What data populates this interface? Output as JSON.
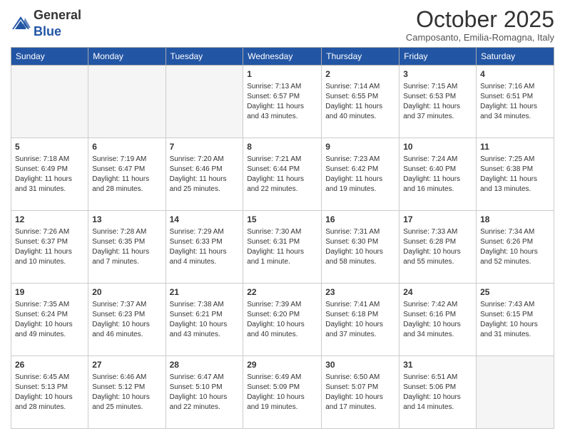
{
  "header": {
    "logo_general": "General",
    "logo_blue": "Blue",
    "month_title": "October 2025",
    "location": "Camposanto, Emilia-Romagna, Italy"
  },
  "days_of_week": [
    "Sunday",
    "Monday",
    "Tuesday",
    "Wednesday",
    "Thursday",
    "Friday",
    "Saturday"
  ],
  "weeks": [
    [
      {
        "day": "",
        "info": ""
      },
      {
        "day": "",
        "info": ""
      },
      {
        "day": "",
        "info": ""
      },
      {
        "day": "1",
        "info": "Sunrise: 7:13 AM\nSunset: 6:57 PM\nDaylight: 11 hours and 43 minutes."
      },
      {
        "day": "2",
        "info": "Sunrise: 7:14 AM\nSunset: 6:55 PM\nDaylight: 11 hours and 40 minutes."
      },
      {
        "day": "3",
        "info": "Sunrise: 7:15 AM\nSunset: 6:53 PM\nDaylight: 11 hours and 37 minutes."
      },
      {
        "day": "4",
        "info": "Sunrise: 7:16 AM\nSunset: 6:51 PM\nDaylight: 11 hours and 34 minutes."
      }
    ],
    [
      {
        "day": "5",
        "info": "Sunrise: 7:18 AM\nSunset: 6:49 PM\nDaylight: 11 hours and 31 minutes."
      },
      {
        "day": "6",
        "info": "Sunrise: 7:19 AM\nSunset: 6:47 PM\nDaylight: 11 hours and 28 minutes."
      },
      {
        "day": "7",
        "info": "Sunrise: 7:20 AM\nSunset: 6:46 PM\nDaylight: 11 hours and 25 minutes."
      },
      {
        "day": "8",
        "info": "Sunrise: 7:21 AM\nSunset: 6:44 PM\nDaylight: 11 hours and 22 minutes."
      },
      {
        "day": "9",
        "info": "Sunrise: 7:23 AM\nSunset: 6:42 PM\nDaylight: 11 hours and 19 minutes."
      },
      {
        "day": "10",
        "info": "Sunrise: 7:24 AM\nSunset: 6:40 PM\nDaylight: 11 hours and 16 minutes."
      },
      {
        "day": "11",
        "info": "Sunrise: 7:25 AM\nSunset: 6:38 PM\nDaylight: 11 hours and 13 minutes."
      }
    ],
    [
      {
        "day": "12",
        "info": "Sunrise: 7:26 AM\nSunset: 6:37 PM\nDaylight: 11 hours and 10 minutes."
      },
      {
        "day": "13",
        "info": "Sunrise: 7:28 AM\nSunset: 6:35 PM\nDaylight: 11 hours and 7 minutes."
      },
      {
        "day": "14",
        "info": "Sunrise: 7:29 AM\nSunset: 6:33 PM\nDaylight: 11 hours and 4 minutes."
      },
      {
        "day": "15",
        "info": "Sunrise: 7:30 AM\nSunset: 6:31 PM\nDaylight: 11 hours and 1 minute."
      },
      {
        "day": "16",
        "info": "Sunrise: 7:31 AM\nSunset: 6:30 PM\nDaylight: 10 hours and 58 minutes."
      },
      {
        "day": "17",
        "info": "Sunrise: 7:33 AM\nSunset: 6:28 PM\nDaylight: 10 hours and 55 minutes."
      },
      {
        "day": "18",
        "info": "Sunrise: 7:34 AM\nSunset: 6:26 PM\nDaylight: 10 hours and 52 minutes."
      }
    ],
    [
      {
        "day": "19",
        "info": "Sunrise: 7:35 AM\nSunset: 6:24 PM\nDaylight: 10 hours and 49 minutes."
      },
      {
        "day": "20",
        "info": "Sunrise: 7:37 AM\nSunset: 6:23 PM\nDaylight: 10 hours and 46 minutes."
      },
      {
        "day": "21",
        "info": "Sunrise: 7:38 AM\nSunset: 6:21 PM\nDaylight: 10 hours and 43 minutes."
      },
      {
        "day": "22",
        "info": "Sunrise: 7:39 AM\nSunset: 6:20 PM\nDaylight: 10 hours and 40 minutes."
      },
      {
        "day": "23",
        "info": "Sunrise: 7:41 AM\nSunset: 6:18 PM\nDaylight: 10 hours and 37 minutes."
      },
      {
        "day": "24",
        "info": "Sunrise: 7:42 AM\nSunset: 6:16 PM\nDaylight: 10 hours and 34 minutes."
      },
      {
        "day": "25",
        "info": "Sunrise: 7:43 AM\nSunset: 6:15 PM\nDaylight: 10 hours and 31 minutes."
      }
    ],
    [
      {
        "day": "26",
        "info": "Sunrise: 6:45 AM\nSunset: 5:13 PM\nDaylight: 10 hours and 28 minutes."
      },
      {
        "day": "27",
        "info": "Sunrise: 6:46 AM\nSunset: 5:12 PM\nDaylight: 10 hours and 25 minutes."
      },
      {
        "day": "28",
        "info": "Sunrise: 6:47 AM\nSunset: 5:10 PM\nDaylight: 10 hours and 22 minutes."
      },
      {
        "day": "29",
        "info": "Sunrise: 6:49 AM\nSunset: 5:09 PM\nDaylight: 10 hours and 19 minutes."
      },
      {
        "day": "30",
        "info": "Sunrise: 6:50 AM\nSunset: 5:07 PM\nDaylight: 10 hours and 17 minutes."
      },
      {
        "day": "31",
        "info": "Sunrise: 6:51 AM\nSunset: 5:06 PM\nDaylight: 10 hours and 14 minutes."
      },
      {
        "day": "",
        "info": ""
      }
    ]
  ]
}
